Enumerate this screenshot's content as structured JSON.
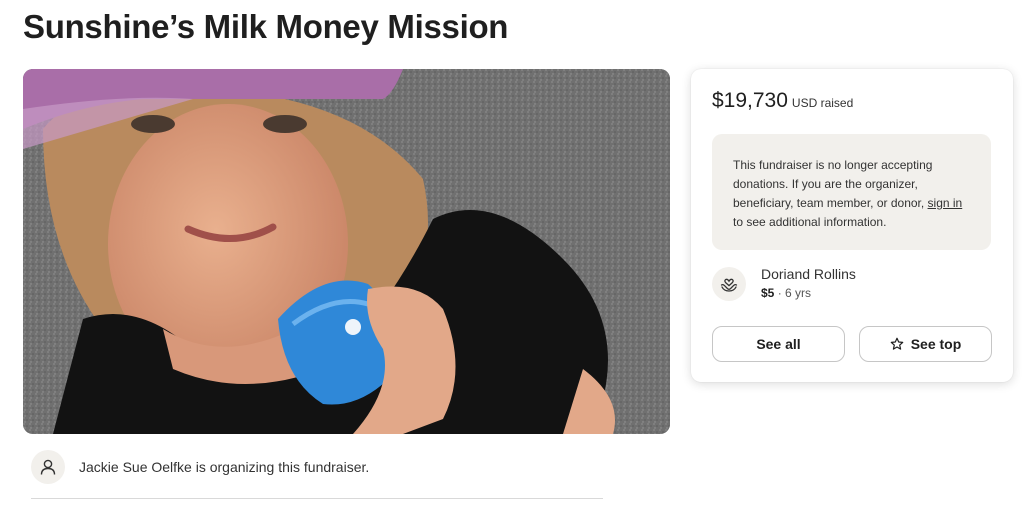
{
  "campaign": {
    "title": "Sunshine’s Milk Money Mission"
  },
  "hero": {
    "icon": "campaign-photo"
  },
  "organizer": {
    "text": "Jackie Sue Oelfke is organizing this fundraiser.",
    "icon": "user-icon"
  },
  "donation_card": {
    "amount": "$19,730",
    "amount_label": "USD raised",
    "notice_text": "This fundraiser is no longer accepting donations. If you are the organizer, beneficiary, team member, or donor, ",
    "notice_link": "sign in",
    "notice_text_end": " to see additional information.",
    "recent_donor": {
      "name": "Doriand Rollins",
      "amount": "$5",
      "separator": " · ",
      "age": "6 yrs",
      "icon": "heart-hands-icon"
    },
    "see_all_label": "See all",
    "see_top_label": "See top",
    "see_top_icon": "star-icon"
  },
  "colors": {
    "panel": "#f2f0ec",
    "text": "#1f1f1f",
    "border": "#c6c6c6"
  }
}
